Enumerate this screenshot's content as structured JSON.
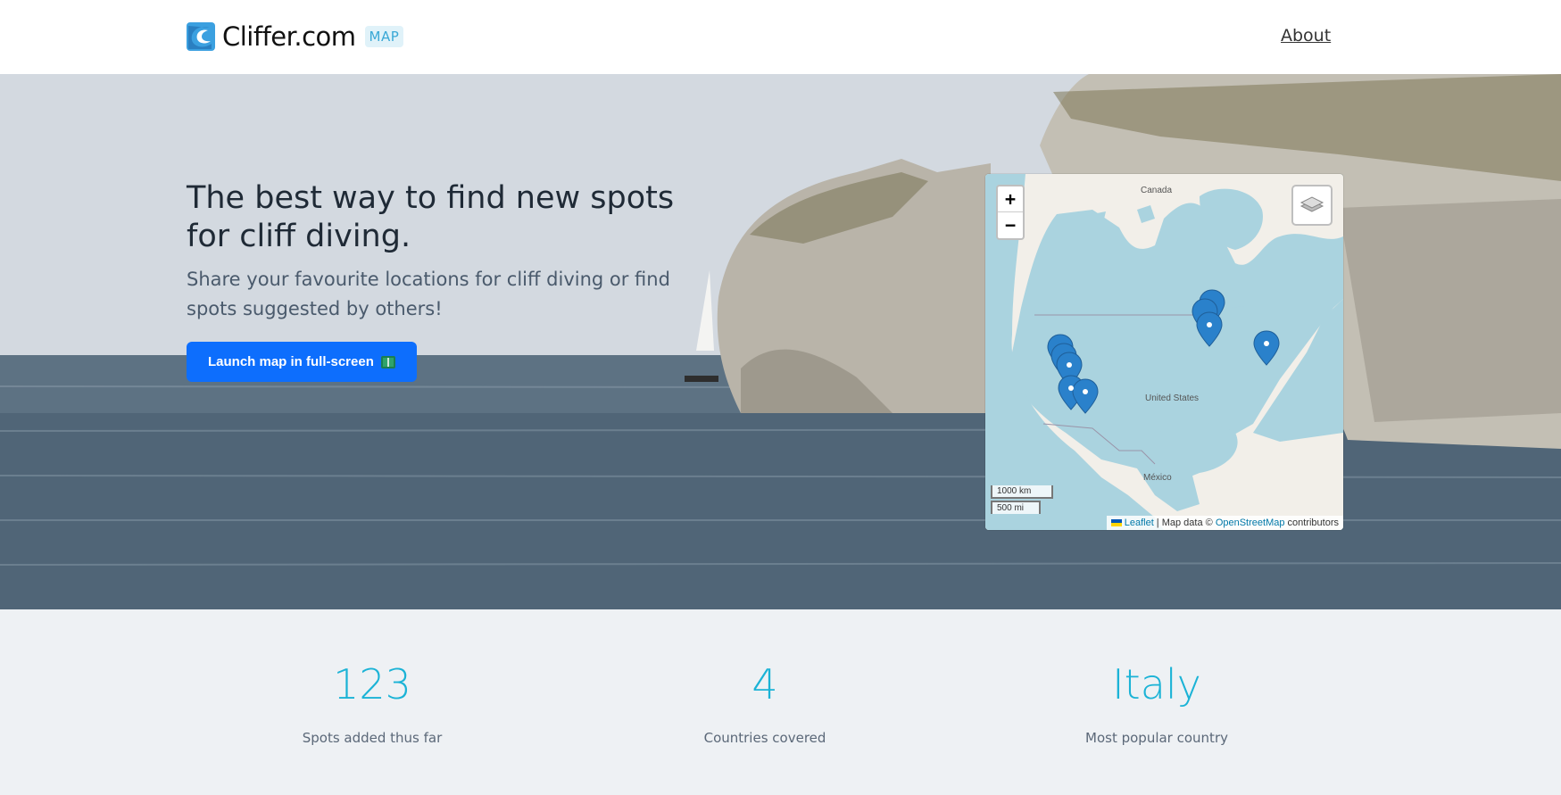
{
  "header": {
    "brand_name": "Cliffer.com",
    "brand_badge": "MAP",
    "nav_about": "About"
  },
  "hero": {
    "title": "The best way to find new spots for cliff diving.",
    "subtitle": "Share your favourite locations for cliff diving or find spots suggested by others!",
    "cta_label": "Launch map in full-screen",
    "cta_icon": "map-icon"
  },
  "map": {
    "zoom_in": "+",
    "zoom_out": "−",
    "labels": {
      "canada": "Canada",
      "united_states": "United States",
      "mexico": "México"
    },
    "scale_km": "1000 km",
    "scale_mi": "500 mi",
    "attribution": {
      "leaflet": "Leaflet",
      "separator": " | Map data © ",
      "osm": "OpenStreetMap",
      "suffix": " contributors"
    },
    "marker_color": "#2a81cb"
  },
  "stats": [
    {
      "value": "123",
      "label": "Spots added thus far"
    },
    {
      "value": "4",
      "label": "Countries covered"
    },
    {
      "value": "Italy",
      "label": "Most popular country"
    }
  ],
  "colors": {
    "accent": "#0d6efd",
    "stat_value": "#1bb3d6",
    "badge_bg": "#e0f2f9"
  }
}
